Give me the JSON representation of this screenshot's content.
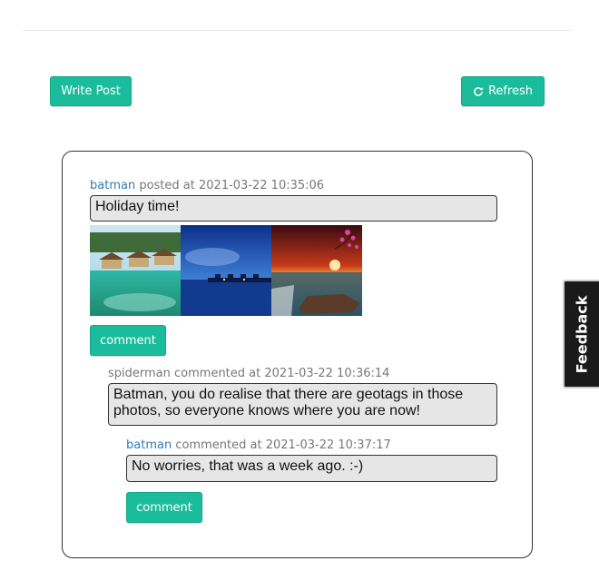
{
  "toolbar": {
    "write_post_label": "Write Post",
    "refresh_label": "Refresh",
    "refresh_icon": "refresh-icon"
  },
  "post": {
    "author": "batman",
    "action": "posted at",
    "timestamp": "2021-03-22 10:35:06",
    "text": "Holiday time!",
    "images": [
      {
        "description": "overwater-bungalows-tropical-lagoon"
      },
      {
        "description": "overwater-villas-at-blue-dusk"
      },
      {
        "description": "sunset-over-rocky-sea-with-blossom-branch"
      }
    ],
    "comment_label": "comment"
  },
  "comments": [
    {
      "author": "spiderman",
      "action": "commented at",
      "timestamp": "2021-03-22 10:36:14",
      "text": "Batman, you do realise that there are geotags in those photos, so everyone knows where you are now!"
    },
    {
      "author": "batman",
      "action": "commented at",
      "timestamp": "2021-03-22 10:37:17",
      "text": "No worries, that was a week ago. :-)",
      "comment_label": "comment"
    }
  ],
  "feedback_tab": {
    "label": "Feedback"
  },
  "colors": {
    "accent": "#1abc9c",
    "link": "#337ab7",
    "bubble": "#e6e6e6"
  }
}
